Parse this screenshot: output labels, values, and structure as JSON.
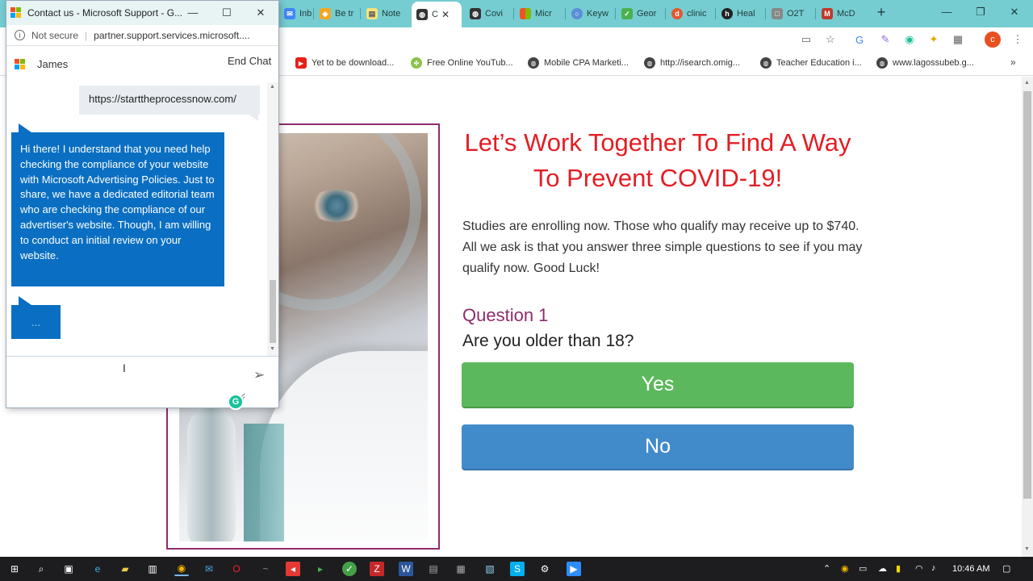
{
  "browser": {
    "tabs": [
      {
        "label": "Inbo",
        "icon": "mail-icon",
        "color": "#4285f4"
      },
      {
        "label": "Be tr",
        "icon": "bookmark-icon",
        "color": "#f4a623"
      },
      {
        "label": "Note",
        "icon": "note-icon",
        "color": "#f7e27e"
      },
      {
        "label": "C",
        "icon": "globe-icon",
        "color": "#333333"
      },
      {
        "label": "Covi",
        "icon": "globe-icon",
        "color": "#333333"
      },
      {
        "label": "Micr",
        "icon": "microsoft-icon",
        "color": "#f25022"
      },
      {
        "label": "Keyw",
        "icon": "circle-icon",
        "color": "#5a8fd6"
      },
      {
        "label": "Geor",
        "icon": "check-icon",
        "color": "#4caf50"
      },
      {
        "label": "clinic",
        "icon": "dd-icon",
        "color": "#e4572e"
      },
      {
        "label": "Heal",
        "icon": "h-icon",
        "color": "#222222"
      },
      {
        "label": "O2T",
        "icon": "box-icon",
        "color": "#888888"
      },
      {
        "label": "McD",
        "icon": "m-icon",
        "color": "#c0392b"
      }
    ],
    "bookmarks": [
      {
        "label": "Yet to be download...",
        "color": "#e62117"
      },
      {
        "label": "Free Online YouTub...",
        "color": "#8bc34a"
      },
      {
        "label": "Mobile CPA Marketi...",
        "color": "#444444"
      },
      {
        "label": "http://isearch.omig...",
        "color": "#444444"
      },
      {
        "label": "Teacher Education i...",
        "color": "#444444"
      },
      {
        "label": "www.lagossubeb.g...",
        "color": "#444444"
      }
    ],
    "more_bookmarks": "»",
    "profile_initial": "c"
  },
  "page": {
    "headline": "Let’s Work Together To Find A Way To Prevent COVID-19!",
    "intro": "Studies are enrolling now. Those who qualify may receive up to $740. All we ask is that you answer three simple questions to see if you may qualify now. Good Luck!",
    "question_label": "Question 1",
    "question_text": "Are you older than 18?",
    "yes_label": "Yes",
    "no_label": "No",
    "colors": {
      "headline": "#e31e24",
      "question": "#8e2c6d",
      "yes": "#5cb85c",
      "no": "#428bca"
    }
  },
  "chat": {
    "window_title": "Contact us - Microsoft Support - G...",
    "security_text": "Not secure",
    "url": "partner.support.services.microsoft....",
    "agent_name": "James",
    "end_chat": "End Chat",
    "user_message": "https://starttheprocessnow.com/",
    "agent_message": "Hi there! I understand that you need help checking the compliance of your website with Microsoft Advertising Policies. Just to share, we have a dedicated editorial team who are checking the compliance of our advertiser's website. Though, I am willing to conduct an initial review on your website.",
    "typing_indicator": "...",
    "input_value": "",
    "input_placeholder": ""
  },
  "taskbar": {
    "clock": "10:46 AM"
  }
}
